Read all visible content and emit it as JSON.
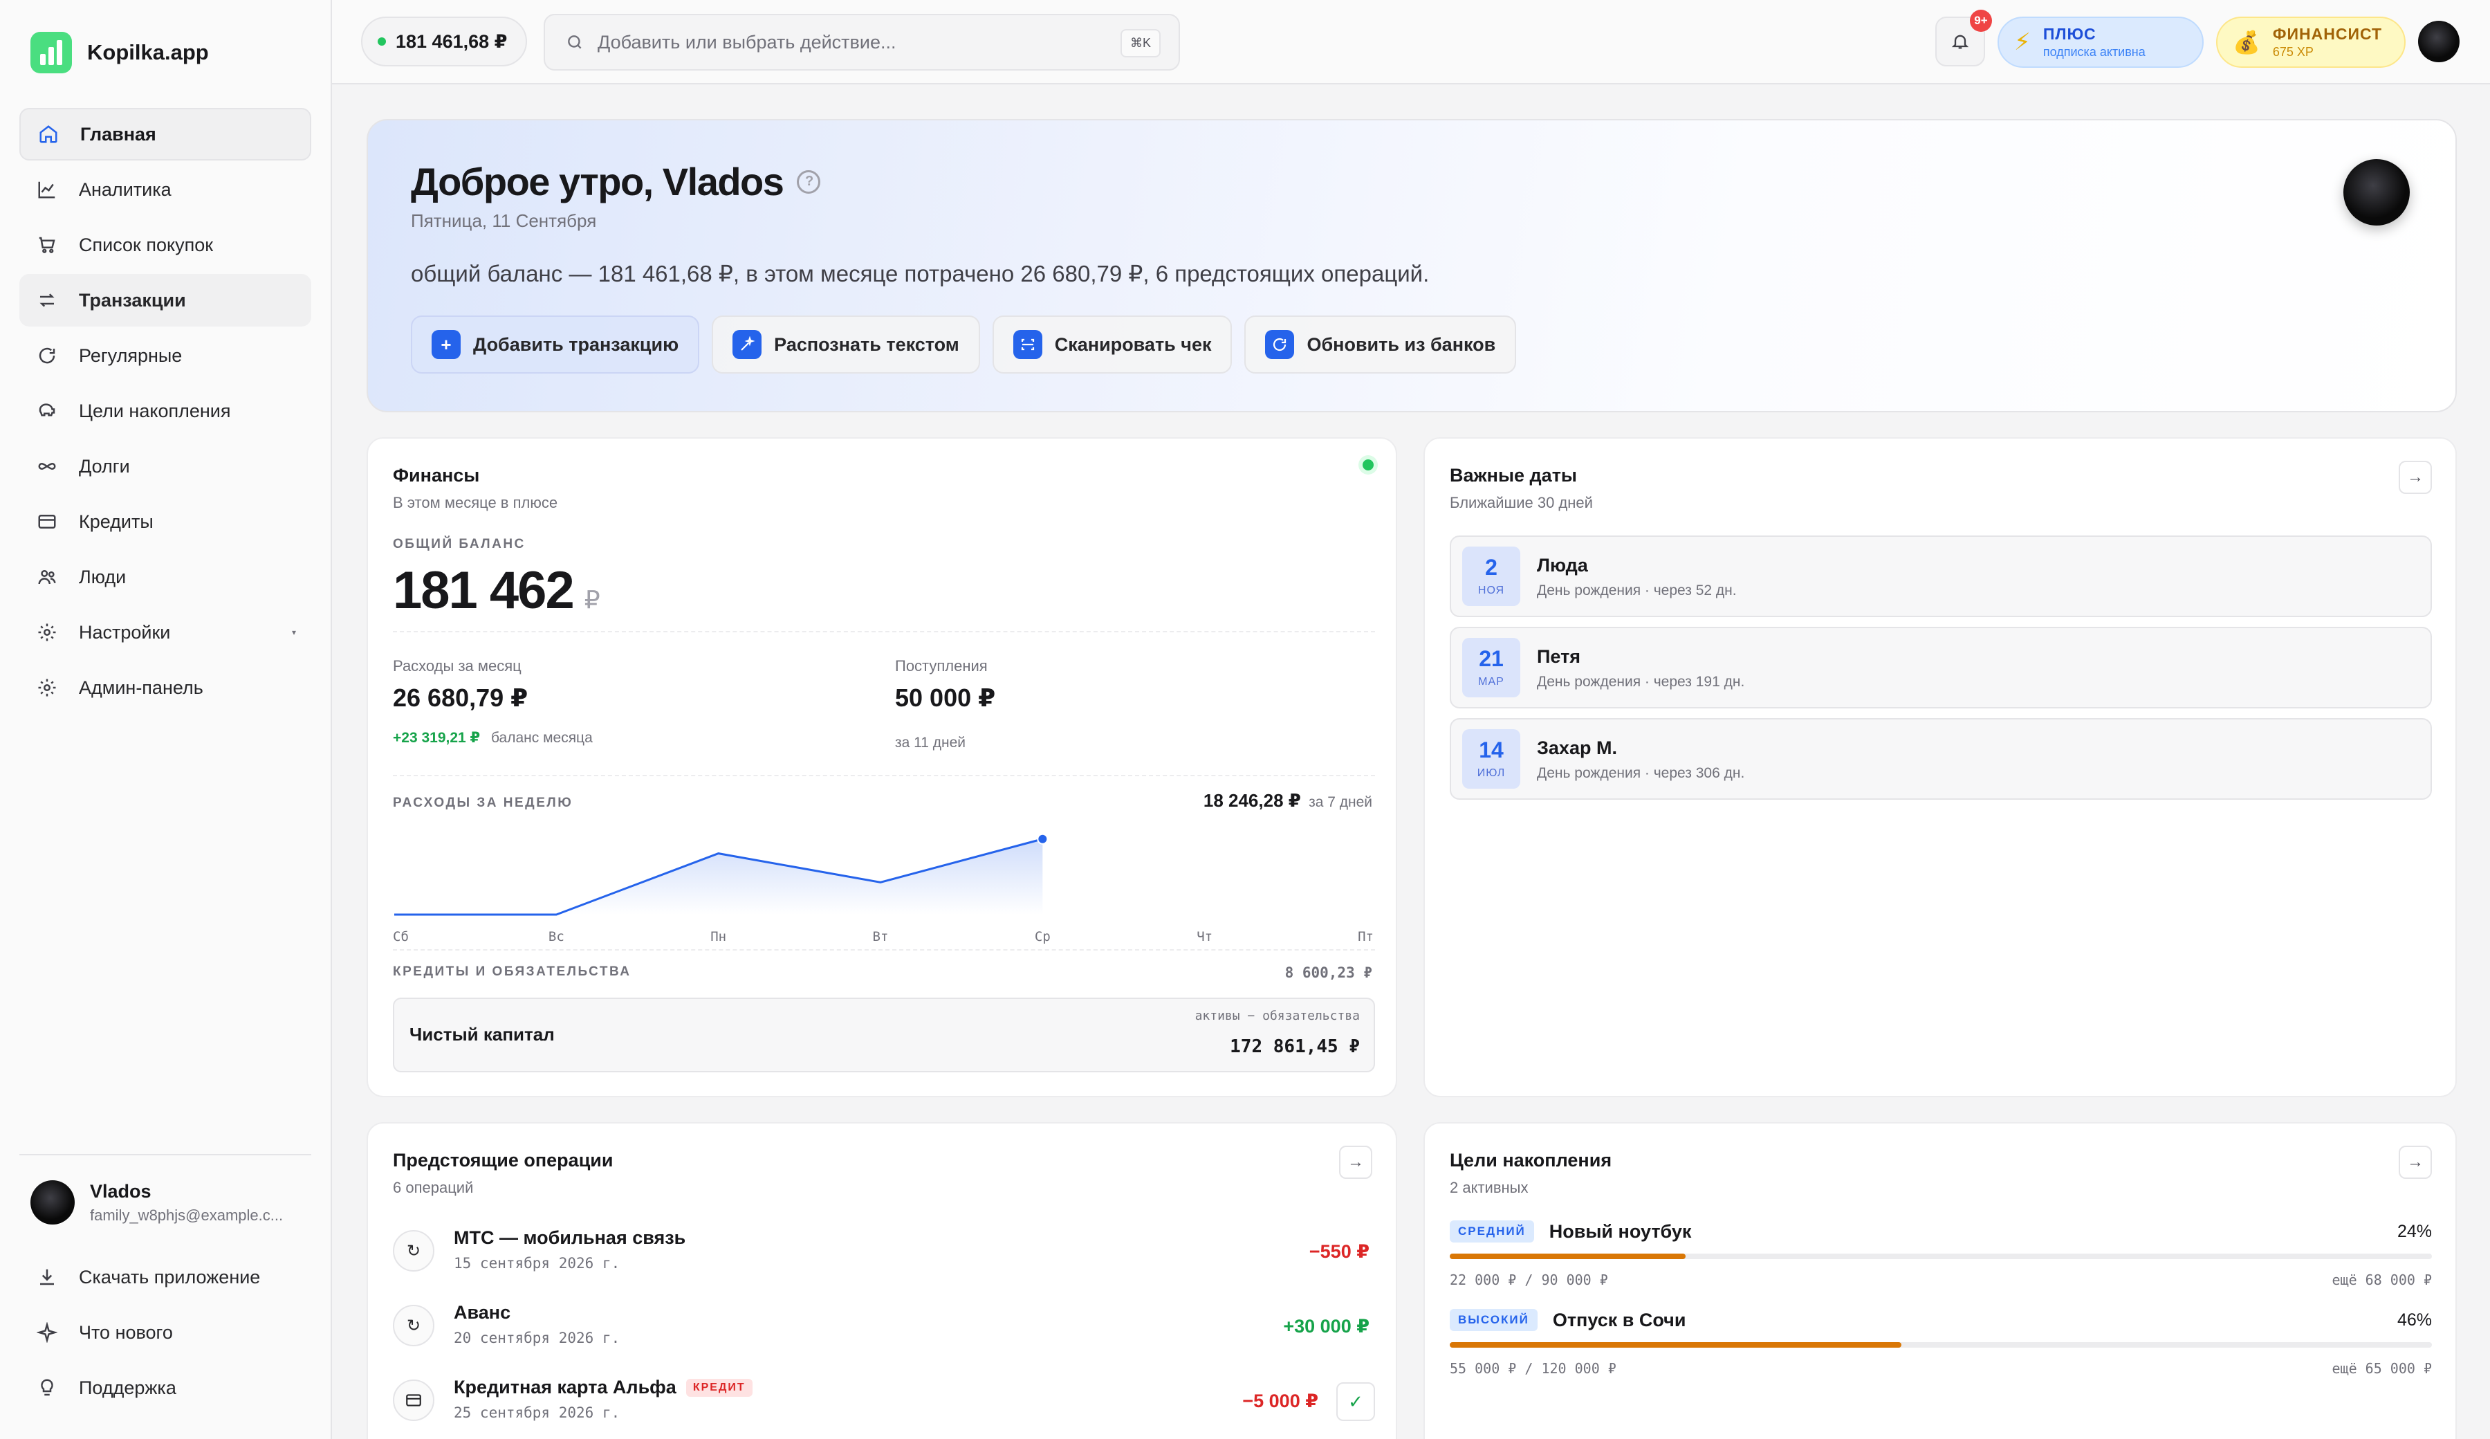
{
  "brand": {
    "name": "Kopilka.app"
  },
  "sidebar": {
    "items": [
      {
        "label": "Главная",
        "icon": "home-icon"
      },
      {
        "label": "Аналитика",
        "icon": "chart-icon"
      },
      {
        "label": "Список покупок",
        "icon": "cart-icon"
      },
      {
        "label": "Транзакции",
        "icon": "transfer-icon"
      },
      {
        "label": "Регулярные",
        "icon": "repeat-icon"
      },
      {
        "label": "Цели накопления",
        "icon": "piggy-bank-icon"
      },
      {
        "label": "Долги",
        "icon": "infinity-icon"
      },
      {
        "label": "Кредиты",
        "icon": "credit-card-icon"
      },
      {
        "label": "Люди",
        "icon": "people-icon"
      },
      {
        "label": "Настройки",
        "icon": "gear-icon"
      },
      {
        "label": "Админ-панель",
        "icon": "admin-gear-icon"
      }
    ],
    "user": {
      "name": "Vlados",
      "email": "family_w8phjs@example.c..."
    },
    "bottom": [
      {
        "label": "Скачать приложение",
        "icon": "download-icon"
      },
      {
        "label": "Что нового",
        "icon": "sparkle-icon"
      },
      {
        "label": "Поддержка",
        "icon": "support-icon"
      }
    ]
  },
  "topbar": {
    "balance": "181 461,68 ₽",
    "search_placeholder": "Добавить или выбрать действие...",
    "shortcut": "⌘K",
    "notif_badge": "9+",
    "plus": {
      "title": "ПЛЮС",
      "sub": "подписка активна"
    },
    "fin": {
      "title": "ФИНАНСИСТ",
      "sub": "675 XP"
    }
  },
  "hero": {
    "greeting": "Доброе утро, Vlados",
    "date": "Пятница, 11 Сентября",
    "summary": "общий баланс — 181 461,68 ₽, в этом месяце потрачено 26 680,79 ₽, 6 предстоящих операций.",
    "actions": [
      "Добавить транзакцию",
      "Распознать текстом",
      "Сканировать чек",
      "Обновить из банков"
    ]
  },
  "finance": {
    "title": "Финансы",
    "subtitle": "В этом месяце в плюсе",
    "total_label": "ОБЩИЙ БАЛАНС",
    "total_value": "181 462",
    "currency": "₽",
    "expenses_label": "Расходы за месяц",
    "expenses_value": "26 680,79 ₽",
    "month_balance_delta": "+23 319,21 ₽",
    "month_balance_label": "баланс месяца",
    "income_label": "Поступления",
    "income_value": "50 000 ₽",
    "income_period": "за 11 дней",
    "week_label": "РАСХОДЫ ЗА НЕДЕЛЮ",
    "week_total": "18 246,28 ₽",
    "week_period": "за 7 дней",
    "credits_label": "КРЕДИТЫ И ОБЯЗАТЕЛЬСТВА",
    "credits_value": "8 600,23 ₽",
    "net_label": "Чистый капитал",
    "net_formula": "активы − обязательства",
    "net_value": "172 861,45 ₽"
  },
  "chart_data": {
    "type": "area",
    "categories": [
      "Сб",
      "Вс",
      "Пн",
      "Вт",
      "Ср",
      "Чт",
      "Пт"
    ],
    "values": [
      0,
      0,
      7200,
      3800,
      8900,
      null,
      null
    ],
    "title": "",
    "xlabel": "",
    "ylabel": "",
    "grid": false,
    "accent": "#2563eb"
  },
  "dates": {
    "title": "Важные даты",
    "subtitle": "Ближайшие 30 дней",
    "items": [
      {
        "day": "2",
        "mon": "НОЯ",
        "name": "Люда",
        "desc": "День рождения · через 52 дн."
      },
      {
        "day": "21",
        "mon": "МАР",
        "name": "Петя",
        "desc": "День рождения · через 191 дн."
      },
      {
        "day": "14",
        "mon": "ИЮЛ",
        "name": "Захар М.",
        "desc": "День рождения · через 306 дн."
      }
    ]
  },
  "upcoming": {
    "title": "Предстоящие операции",
    "subtitle": "6 операций",
    "items": [
      {
        "name": "МТС — мобильная связь",
        "date": "15 сентября 2026 г.",
        "amount": "−550 ₽",
        "icon": "repeat-icon"
      },
      {
        "name": "Аванс",
        "date": "20 сентября 2026 г.",
        "amount": "+30 000 ₽",
        "icon": "repeat-icon"
      },
      {
        "name": "Кредитная карта Альфа",
        "date": "25 сентября 2026 г.",
        "amount": "−5 000 ₽",
        "tag": "КРЕДИТ",
        "icon": "credit-card-icon"
      }
    ]
  },
  "goals": {
    "title": "Цели накопления",
    "subtitle": "2 активных",
    "items": [
      {
        "priority": "СРЕДНИЙ",
        "name": "Новый ноутбук",
        "percent": "24%",
        "progress": 0.24,
        "saved": "22 000 ₽ / 90 000 ₽",
        "left": "ещё 68 000 ₽"
      },
      {
        "priority": "ВЫСОКИЙ",
        "name": "Отпуск в Сочи",
        "percent": "46%",
        "progress": 0.46,
        "saved": "55 000 ₽ / 120 000 ₽",
        "left": "ещё 65 000 ₽"
      }
    ]
  },
  "colors": {
    "accent": "#2563eb",
    "positive": "#16a34a",
    "negative": "#dc2626",
    "goal_bar": "#d97706"
  }
}
